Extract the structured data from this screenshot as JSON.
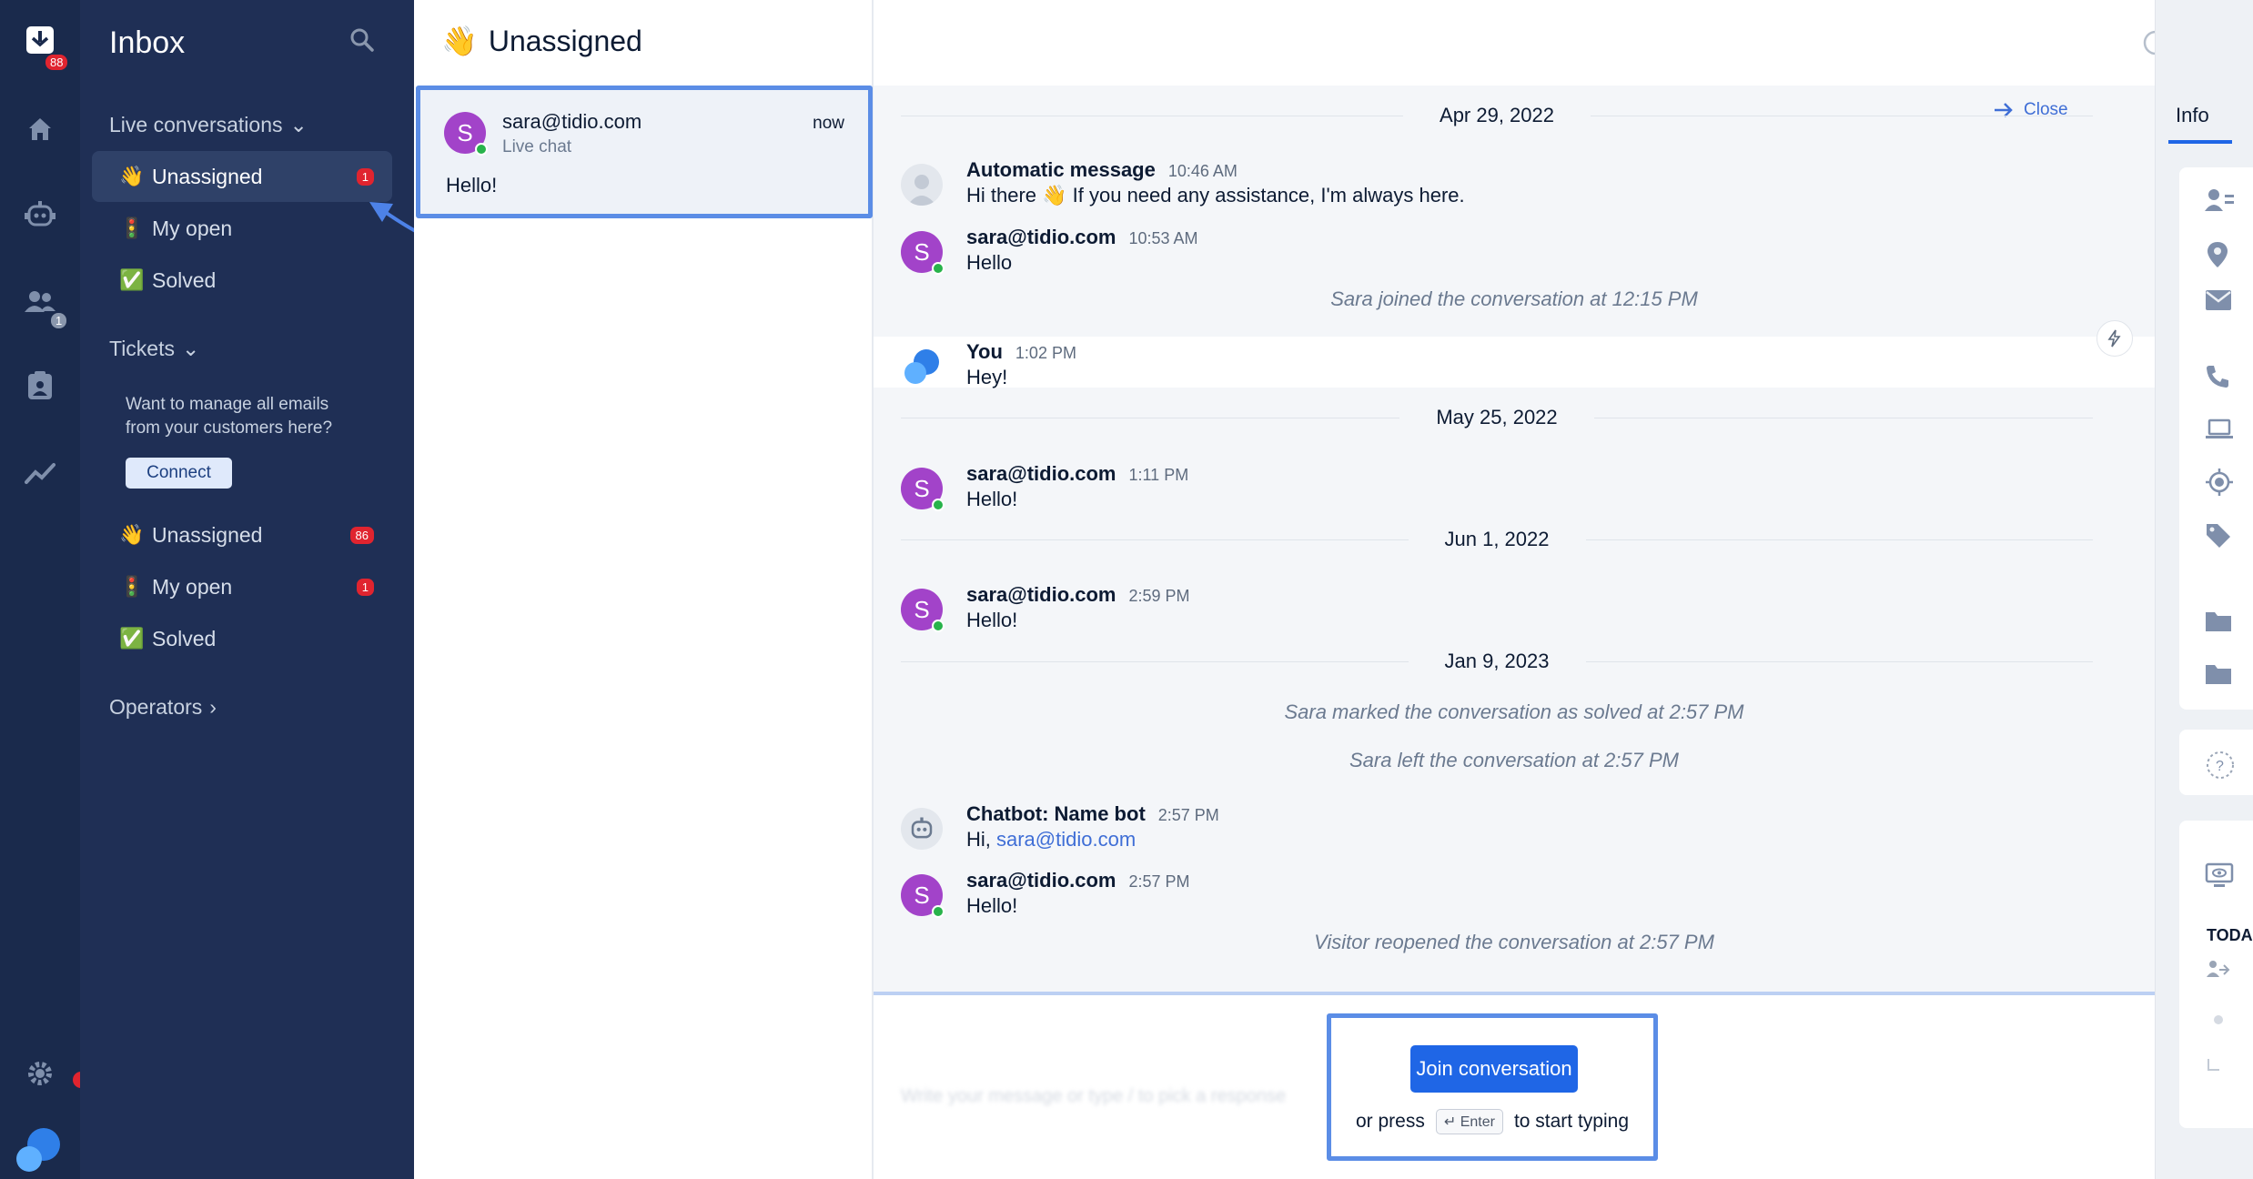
{
  "rail": {
    "inbox_badge": "88",
    "contacts_badge": "1"
  },
  "sidebar": {
    "title": "Inbox",
    "live_section": "Live conversations",
    "live_items": [
      {
        "emoji": "👋",
        "label": "Unassigned",
        "badge": "1"
      },
      {
        "emoji": "🚦",
        "label": "My open",
        "badge": ""
      },
      {
        "emoji": "✅",
        "label": "Solved",
        "badge": ""
      }
    ],
    "tickets_section": "Tickets",
    "promo_text": "Want to manage all emails from your customers here?",
    "connect_label": "Connect",
    "ticket_items": [
      {
        "emoji": "👋",
        "label": "Unassigned",
        "badge": "86"
      },
      {
        "emoji": "🚦",
        "label": "My open",
        "badge": "1"
      },
      {
        "emoji": "✅",
        "label": "Solved",
        "badge": ""
      }
    ],
    "operators_section": "Operators"
  },
  "list": {
    "heading_emoji": "👋",
    "heading": "Unassigned",
    "conversation": {
      "initial": "S",
      "email": "sara@tidio.com",
      "channel": "Live chat",
      "time": "now",
      "preview": "Hello!"
    }
  },
  "chat": {
    "close_label": "Close",
    "dates": [
      "Apr 29, 2022",
      "May 25, 2022",
      "Jun 1, 2022",
      "Jan 9, 2023"
    ],
    "messages": [
      {
        "name": "Automatic message",
        "time": "10:46 AM",
        "text": "Hi there 👋 If you need any assistance, I'm always here."
      },
      {
        "name": "sara@tidio.com",
        "time": "10:53 AM",
        "text": "Hello"
      },
      {
        "name": "You",
        "time": "1:02 PM",
        "text": "Hey!"
      },
      {
        "name": "sara@tidio.com",
        "time": "1:11 PM",
        "text": "Hello!"
      },
      {
        "name": "sara@tidio.com",
        "time": "2:59 PM",
        "text": "Hello!"
      },
      {
        "name": "Chatbot: Name bot",
        "time": "2:57 PM",
        "text_prefix": "Hi, ",
        "text_link": "sara@tidio.com"
      },
      {
        "name": "sara@tidio.com",
        "time": "2:57 PM",
        "text": "Hello!"
      }
    ],
    "system": [
      "Sara joined the conversation at 12:15 PM",
      "Sara marked the conversation as solved at 2:57 PM",
      "Sara left the conversation at 2:57 PM",
      "Visitor reopened the conversation at 2:57 PM"
    ],
    "avatar_initial": "S",
    "composer_placeholder": "Write your message or type / to pick a response",
    "join_label": "Join conversation",
    "hint_before": "or press",
    "hint_key": "↵ Enter",
    "hint_after": "to start typing"
  },
  "info": {
    "tab_label": "Info",
    "today_label": "TODA"
  },
  "colors": {
    "rail_bg": "#1a2a4c",
    "sidebar_bg": "#1f2f55",
    "accent": "#1f66e6",
    "highlight": "#5b8de6",
    "avatar": "#a243c9",
    "online": "#28b34b",
    "badge": "#e0242f"
  }
}
